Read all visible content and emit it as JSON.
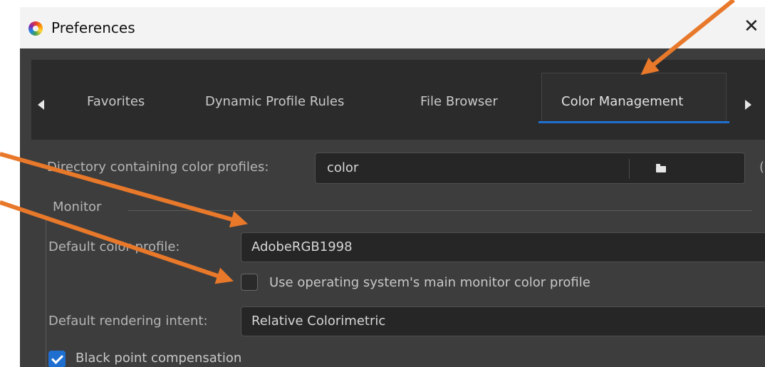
{
  "window": {
    "title": "Preferences",
    "close_glyph": "✕"
  },
  "tabs": [
    {
      "label": "Favorites"
    },
    {
      "label": "Dynamic Profile Rules"
    },
    {
      "label": "File Browser"
    },
    {
      "label": "Color Management",
      "active": true
    }
  ],
  "directory": {
    "label": "Directory containing color profiles:",
    "value": "color",
    "note": "(restart r"
  },
  "monitor": {
    "group_label": "Monitor",
    "profile_label": "Default color profile:",
    "profile_value": "AdobeRGB1998",
    "use_os_label": "Use operating system's main monitor color profile",
    "use_os_checked": false,
    "intent_label": "Default rendering intent:",
    "intent_value": "Relative Colorimetric",
    "bpc_label": "Black point compensation",
    "bpc_checked": true
  },
  "colors": {
    "accent": "#1f6fd1",
    "annotation_arrow": "#e8782a",
    "panel_bg": "#3d3d3d",
    "tabbar_bg": "#2b2b2b"
  },
  "icons": [
    "color-wheel-icon",
    "close-icon",
    "chevron-left-icon",
    "chevron-right-icon",
    "folder-icon",
    "checkmark-icon"
  ]
}
